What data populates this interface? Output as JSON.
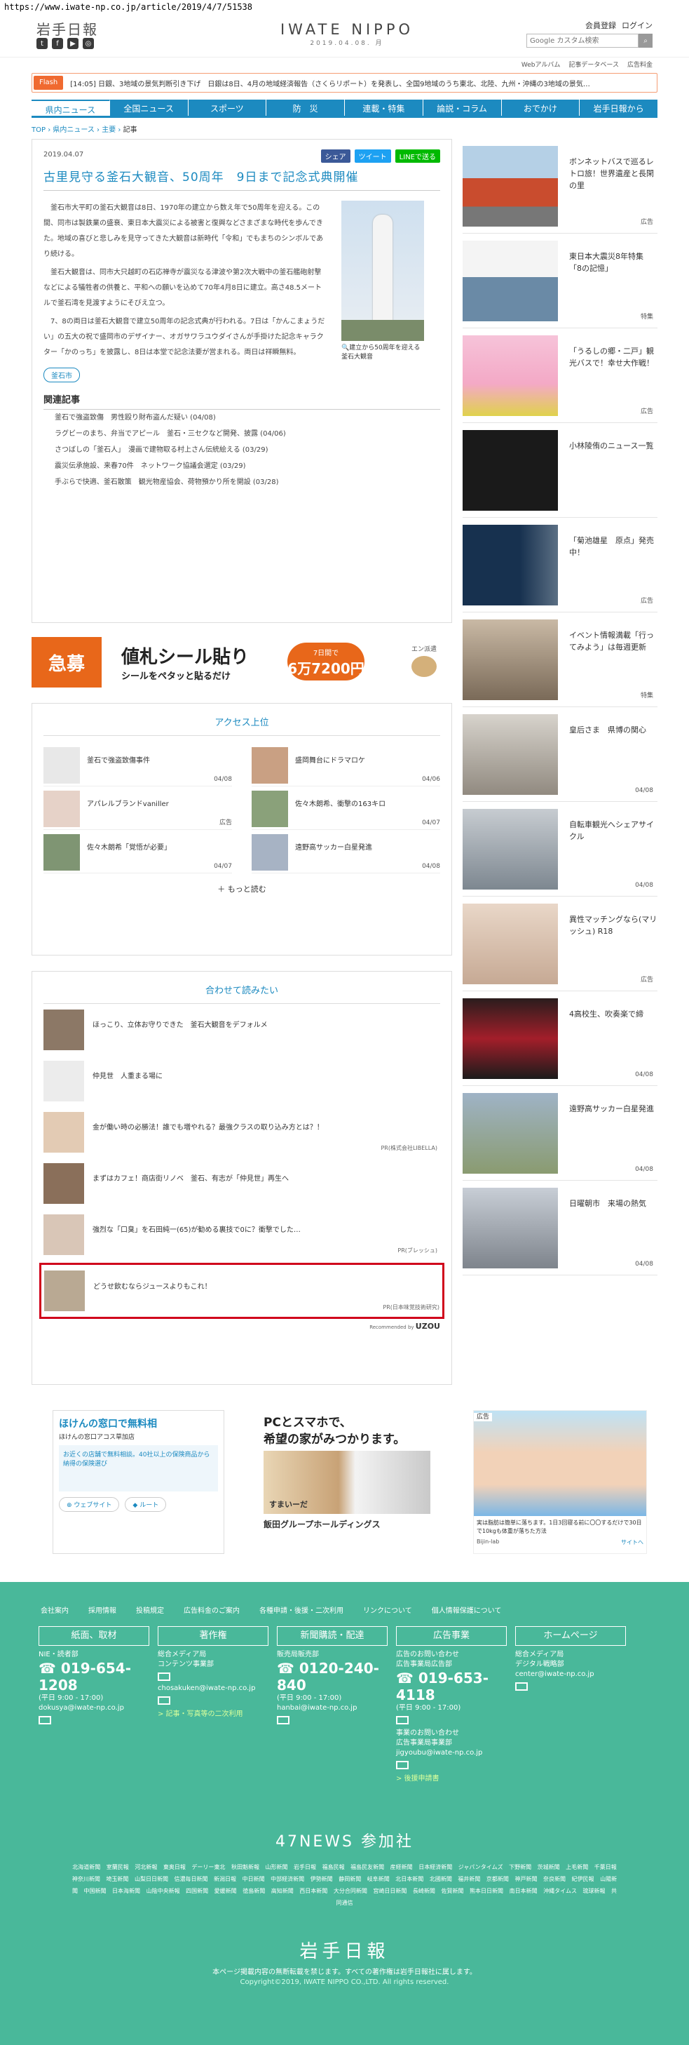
{
  "url": "https://www.iwate-np.co.jp/article/2019/4/7/51538",
  "header": {
    "brand": "岩手日報",
    "center_title": "IWATE NIPPO",
    "center_date": "2019.04.08. 月",
    "member_link": "会員登録",
    "login_link": "ログイン",
    "search_placeholder": "Google カスタム検索",
    "sublinks": [
      "Webアルバム",
      "記事データベース",
      "広告料金"
    ]
  },
  "flash": {
    "label": "Flash",
    "text": "[14:05] 日銀、3地域の景気判断引き下げ　日銀は8日、4月の地域経済報告（さくらリポート）を発表し、全国9地域のうち東北、北陸、九州・沖縄の3地域の景気…"
  },
  "nav": [
    "県内ニュース",
    "全国ニュース",
    "スポーツ",
    "防　災",
    "連載・特集",
    "論説・コラム",
    "おでかけ",
    "岩手日報から"
  ],
  "breadcrumb": [
    "TOP",
    "県内ニュース",
    "主要",
    "記事"
  ],
  "article": {
    "date": "2019.04.07",
    "share": {
      "fb": "シェア",
      "tw": "ツイート",
      "line": "LINEで送る"
    },
    "title": "古里見守る釜石大観音、50周年　9日まで記念式典開催",
    "p1": "釜石市大平町の釜石大観音は8日、1970年の建立から数え年で50周年を迎える。この間、同市は製鉄業の盛衰、東日本大震災による被害と復興などさまざまな時代を歩んできた。地域の喜びと悲しみを見守ってきた大観音は新時代「令和」でもまちのシンボルであり続ける。",
    "p2": "釜石大観音は、同市大只越町の石応禅寺が震災なる津波や第2次大戦中の釜石艦砲射撃などによる犠牲者の供養と、平和への願いを込めて70年4月8日に建立。高さ48.5メートルで釜石湾を見渡すようにそびえ立つ。",
    "p3": "7、8の両日は釜石大観音で建立50周年の記念式典が行われる。7日は「かんこまょうだい」の五大の祝で盛岡市のデザイナー、オガサワラユウダイさんが手掛けた記念キャラクター「かのっち」を披露し、8日は本堂で記念法要が営まれる。両日は祥瞬無料。",
    "caption": "建立から50周年を迎える釜石大観音",
    "tag": "釜石市",
    "related_heading": "関連記事",
    "related": [
      "釜石で強盗致傷　男性殴り財布盗んだ疑い (04/08)",
      "ラグビーのまち、弁当でアピール　釜石・三セクなど開発、披露 (04/06)",
      "さつばしの「釜石人」　漫画で建物取る村上さん伝統絵える (03/29)",
      "震災伝承施設、来春70件　ネットワーク協議会選定 (03/29)",
      "手ぶらで快適、釜石散策　観光物産協会、荷物預かり所を開設 (03/28)"
    ]
  },
  "ad_banner": {
    "kyubo": "急募",
    "main": "値札シール貼り",
    "sub": "シールをペタッと貼るだけ",
    "pay_small": "7日間で",
    "pay_amount": "6万7200円",
    "logo": "エン派遣"
  },
  "ranking": {
    "heading": "アクセス上位",
    "items": [
      {
        "title": "釜石で強盗致傷事件",
        "date": "04/08"
      },
      {
        "title": "盛岡舞台にドラマロケ",
        "date": "04/06"
      },
      {
        "title": "アパレルブランドvaniller",
        "date": "広告"
      },
      {
        "title": "佐々木朗希、衝撃の163キロ",
        "date": "04/07"
      },
      {
        "title": "佐々木朗希「覚悟が必要」",
        "date": "04/07"
      },
      {
        "title": "遠野高サッカー白星発進",
        "date": "04/08"
      }
    ],
    "more": "もっと読む"
  },
  "recommend": {
    "heading": "合わせて読みたい",
    "items": [
      {
        "title": "ほっこり、立体お守りできた　釜石大観音をデフォルメ",
        "src": ""
      },
      {
        "title": "仲見世　人重まる場に",
        "src": ""
      },
      {
        "title": "金が働い時の必勝法！誰でも増やれる？最強クラスの取り込み方とは？！",
        "src": "PR(株式会社LIBELLA)"
      },
      {
        "title": "まずはカフェ！商店街リノベ　釜石、有志が「仲見世」再生へ",
        "src": ""
      },
      {
        "title": "強烈な「口臭」を石田純一(65)が勧める裏技で0に？衝撃でした…",
        "src": "PR(ブレッシュ)"
      },
      {
        "title": "どうせ飲むならジュースよりもこれ！",
        "src": "PR(日本味覚技術研究)"
      }
    ],
    "recommended_by": "Recommended by",
    "brand": "UZOU"
  },
  "bottom_ads": {
    "map": {
      "title": "ほけんの窓口で無料相",
      "sub": "ほけんの窓口アコス草加店",
      "box": "お近くの店舗で無料相談。40社以上の保険商品から納得の保険選び",
      "btn1": "ウェブサイト",
      "btn2": "ルート"
    },
    "house": {
      "line1": "PCとスマホで、",
      "line2": "希望の家がみつかります。",
      "brand": "すまいーだ",
      "foot": "飯田グループホールディングス"
    },
    "body": {
      "label": "広告",
      "text": "実は脂肪は簡単に落ちます。1日3回寝る前に〇〇するだけで30日で10kgも体重が落ちた方法",
      "src": "Bijin-lab",
      "more": "サイトへ"
    }
  },
  "sidebar": [
    {
      "title": "ボンネットバスで巡るレトロ旅！世界遺産と長閑の里",
      "date": "広告"
    },
    {
      "title": "東日本大震災8年特集　「8の記憶」",
      "date": "特集"
    },
    {
      "title": "「うるしの郷・二戸」観光バスで！幸せ大作戦！",
      "date": "広告"
    },
    {
      "title": "小林陵侑のニュース一覧",
      "date": ""
    },
    {
      "title": "「菊池雄星　原点」発売中！",
      "date": "広告"
    },
    {
      "title": "イベント情報満載「行ってみよう」は毎週更新",
      "date": "特集"
    },
    {
      "title": "皇后さま　県博の関心",
      "date": "04/08"
    },
    {
      "title": "自転車観光へシェアサイクル",
      "date": "04/08"
    },
    {
      "title": "異性マッチングなら(マリッシュ) R18",
      "date": "広告"
    },
    {
      "title": "4高校生、吹奏楽で締",
      "date": "04/08"
    },
    {
      "title": "遠野高サッカー白星発進",
      "date": "04/08"
    },
    {
      "title": "日曜朝市　来場の熱気",
      "date": "04/08"
    }
  ],
  "footer": {
    "links": [
      "会社案内",
      "採用情報",
      "投稿規定",
      "広告料金のご案内",
      "各種申請・後援・二次利用",
      "リンクについて",
      "個人情報保護について"
    ],
    "cols": [
      {
        "heading": "紙面、取材",
        "l1": "NIE・読者部",
        "tel": "019-654-1208",
        "hours": "(平日 9:00 - 17:00)",
        "mail": "dokusya@iwate-np.co.jp",
        "link": ""
      },
      {
        "heading": "著作権",
        "l1": "総合メディア局",
        "l2": "コンテンツ事業部",
        "mail": "chosakuken@iwate-np.co.jp",
        "link": "> 記事・写真等の二次利用"
      },
      {
        "heading": "新聞購読・配達",
        "l1": "販売局販売部",
        "tel": "0120-240-840",
        "hours": "(平日 9:00 - 17:00)",
        "mail": "hanbai@iwate-np.co.jp",
        "link": ""
      },
      {
        "heading": "広告事業",
        "l1": "広告のお問い合わせ",
        "l2": "広告事業局広告部",
        "tel": "019-653-4118",
        "hours": "(平日 9:00 - 17:00)",
        "l3": "事業のお問い合わせ",
        "l4": "広告事業局事業部",
        "mail": "jigyoubu@iwate-np.co.jp",
        "link": "> 後援申請書"
      },
      {
        "heading": "ホームページ",
        "l1": "総合メディア局",
        "l2": "デジタル戦略部",
        "mail": "center@iwate-np.co.jp",
        "link": ""
      }
    ],
    "news47": "47NEWS 参加社",
    "papers": "北海道新聞 室蘭民報 河北新報 東奥日報 デーリー東北 秋田魁新報 山形新聞 岩手日報 福島民報 福島民友新聞 産経新聞 日本経済新聞 ジャパンタイムズ 下野新聞 茨城新聞 上毛新聞 千葉日報 神奈川新聞 埼玉新聞 山梨日日新聞 信濃毎日新聞 新潟日報 中日新聞 中部経済新聞 伊勢新聞 静岡新聞 岐阜新聞 北日本新聞 北國新聞 福井新聞 京都新聞 神戸新聞 奈良新聞 紀伊民報 山陽新聞 中国新聞 日本海新聞 山陰中央新報 四国新聞 愛媛新聞 徳島新聞 高知新聞 西日本新聞 大分合同新聞 宮崎日日新聞 長崎新聞 佐賀新聞 熊本日日新聞 南日本新聞 沖縄タイムス 琉球新報 共同通信",
    "brand": "岩手日報",
    "copy1": "本ページ掲載内容の無断転載を禁じます。すべての著作権は岩手日報社に属します。",
    "copy2": "Copyright©2019, IWATE NIPPO CO.,LTD. All rights reserved."
  }
}
